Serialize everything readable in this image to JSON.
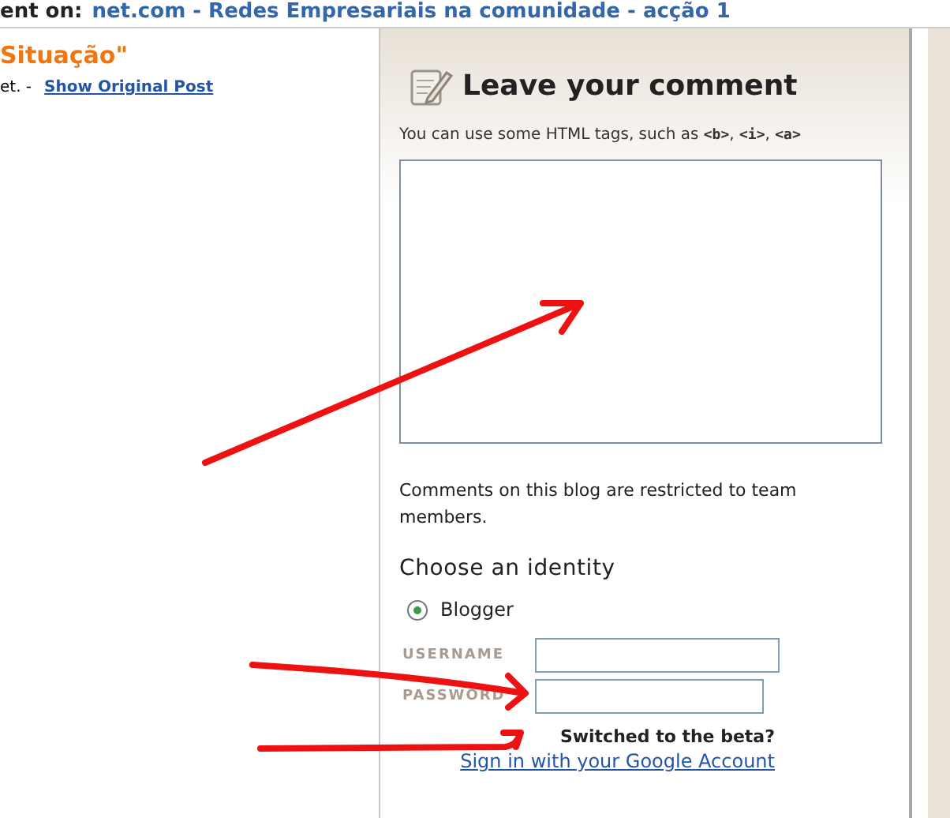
{
  "header": {
    "prefix": "ent on:",
    "link": "net.com - Redes Empresariais na comunidade - acção 1"
  },
  "post": {
    "title": "Situação\"",
    "excerpt": "et. -",
    "link": "Show Original Post"
  },
  "comment_form": {
    "title": "Leave your comment",
    "hint": "You can use some HTML tags, such as **<b>**, **<i>**, **<a>**",
    "notice": "Comments on this blog are restricted to team members.",
    "identity_heading": "Choose an identity",
    "identities": [
      {
        "label": "Blogger",
        "selected": true
      }
    ],
    "fields": [
      {
        "label": "USERNAME",
        "kind": "text"
      },
      {
        "label": "PASSWORD",
        "kind": "password"
      }
    ],
    "beta_question": "Switched to the beta?",
    "beta_link": "Sign in with your Google Account"
  }
}
